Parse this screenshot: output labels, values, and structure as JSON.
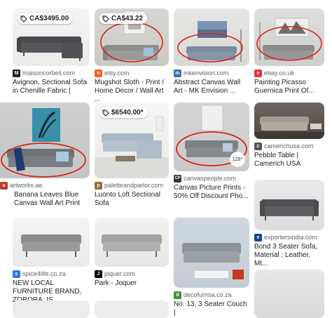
{
  "colors": {
    "accent_red": "#d62418",
    "link_blue": "#1a0dab",
    "text": "#202124",
    "muted": "#5f6368"
  },
  "cards": [
    {
      "id": "c1",
      "price": "CA$3495.00",
      "favicon": "M",
      "domain": "maisoncorbeil.com",
      "title": "Avignon, Sectional Sofa in Chenille Fabric |"
    },
    {
      "id": "c2",
      "price": "CA$43.22",
      "favicon": "e",
      "domain": "etsy.com",
      "title": "Mugshot Sloth - Print / Home Decor / Wall Art ..."
    },
    {
      "id": "c3",
      "favicon": "m",
      "domain": "mkenvision.com",
      "title": "Abstract Canvas Wall Art - MK Envision ..."
    },
    {
      "id": "c4",
      "favicon": "e",
      "domain": "ebay.co.uk",
      "title": "Painting Picasso Guernica Print Of..."
    },
    {
      "id": "c5",
      "favicon": "a",
      "domain": "artworks.ae",
      "title": "Banana Leaves Blue Canvas Wall Art Print"
    },
    {
      "id": "c6",
      "price": "$6540.00*",
      "favicon": "p",
      "domain": "paletteandparlor.com",
      "title": "Luonto Loft Sectional Sofa"
    },
    {
      "id": "c7",
      "favicon": "CP",
      "domain": "canvaspeople.com",
      "title": "Canvas Picture Prints - 50% Off Discount Pho...",
      "badge": "125°"
    },
    {
      "id": "c8",
      "favicon": "c",
      "domain": "camerichusa.com",
      "title": "Pebble Table | Camerich USA"
    },
    {
      "id": "c9",
      "favicon": "s",
      "domain": "spice4life.co.za",
      "title": "NEW LOCAL FURNITURE BRAND, ZORORA, IS ..."
    },
    {
      "id": "c10",
      "favicon": "J",
      "domain": "joquer.com",
      "title": "Park - Joquer"
    },
    {
      "id": "c11",
      "favicon": "d",
      "domain": "decofurnsa.co.za",
      "title": "No. 13, 3 Seater Couch |"
    },
    {
      "id": "c12",
      "favicon": "e",
      "domain": "exportersindia.com",
      "title": "Bond 3 Seater Sofa, Material : Leather, Mt..."
    }
  ]
}
